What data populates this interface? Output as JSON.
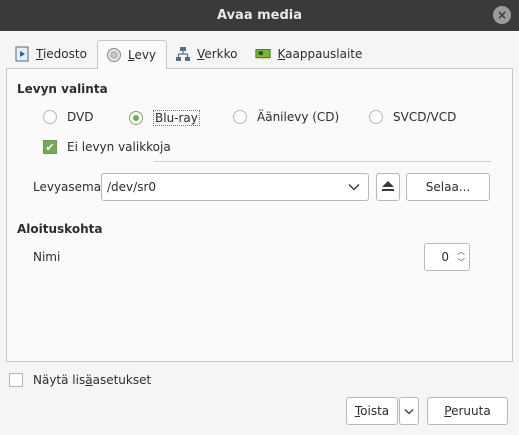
{
  "window": {
    "title": "Avaa media"
  },
  "tabs": [
    {
      "label": "Tiedosto",
      "mnemonic": "T",
      "rest": "iedosto",
      "icon": "file-play-icon"
    },
    {
      "label": "Levy",
      "mnemonic": "L",
      "rest": "evy",
      "icon": "disc-icon",
      "active": true
    },
    {
      "label": "Verkko",
      "mnemonic": "V",
      "rest": "erkko",
      "icon": "network-icon"
    },
    {
      "label": "Kaappauslaite",
      "mnemonic": "K",
      "rest": "aappauslaite",
      "icon": "capture-card-icon"
    }
  ],
  "disc_selection": {
    "title": "Levyn valinta",
    "options": [
      {
        "label": "DVD",
        "checked": false
      },
      {
        "label": "Blu-ray",
        "checked": true
      },
      {
        "label": "Äänilevy (CD)",
        "checked": false
      },
      {
        "label": "SVCD/VCD",
        "checked": false
      }
    ],
    "no_menus": {
      "label": "Ei levyn valikkoja",
      "checked": true
    }
  },
  "device": {
    "label": "Levyasema",
    "value": "/dev/sr0",
    "browse_label": "Selaa..."
  },
  "start_position": {
    "title": "Aloituskohta",
    "title_label": "Nimi",
    "title_value": "0"
  },
  "footer": {
    "advanced": {
      "prefix": "Näytä lis",
      "mnemonic": "ä",
      "suffix": "asetukset",
      "checked": false
    },
    "play": {
      "mnemonic": "T",
      "rest": "oista"
    },
    "cancel": {
      "mnemonic": "P",
      "rest": "eruuta"
    }
  },
  "colors": {
    "titlebar": "#3a3b39",
    "accent": "#74a857",
    "panel": "#fafafa",
    "background": "#f5f5f5"
  }
}
